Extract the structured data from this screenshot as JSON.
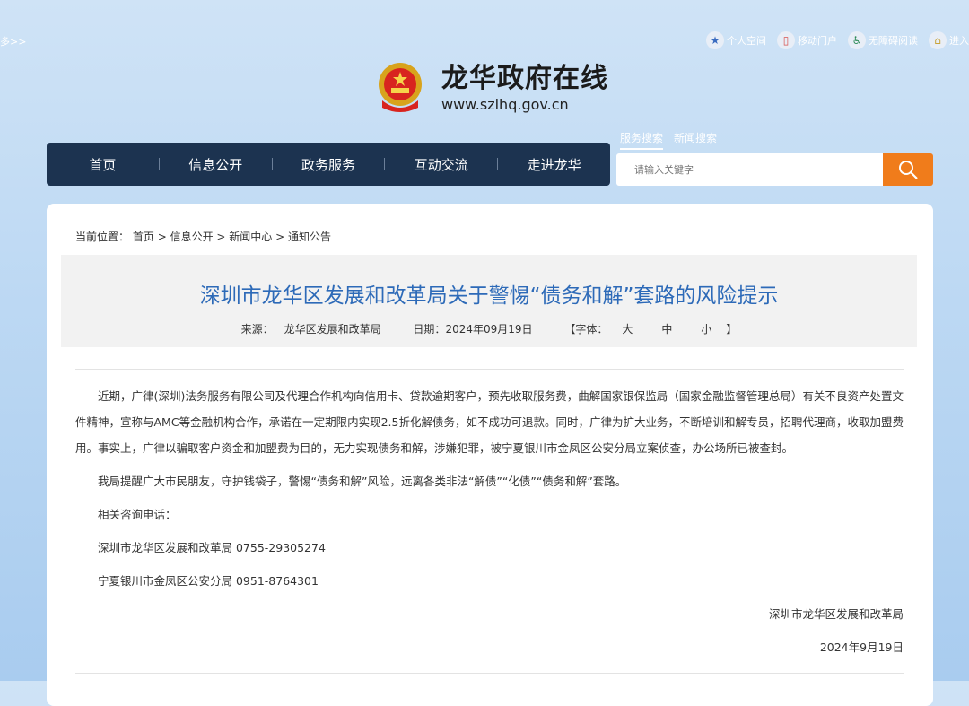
{
  "header": {
    "more_link": "多>>",
    "top_links": [
      {
        "label": "个人空间",
        "icon": "user-star-icon"
      },
      {
        "label": "移动门户",
        "icon": "mobile-icon"
      },
      {
        "label": "无障碍阅读",
        "icon": "accessibility-icon"
      },
      {
        "label": "进入",
        "icon": "enter-icon"
      }
    ],
    "site_title": "龙华政府在线",
    "site_url": "www.szlhq.gov.cn"
  },
  "nav": {
    "items": [
      "首页",
      "信息公开",
      "政务服务",
      "互动交流",
      "走进龙华"
    ]
  },
  "search": {
    "tabs": [
      "服务搜索",
      "新闻搜索"
    ],
    "placeholder": "请输入关键字"
  },
  "breadcrumb": {
    "label": "当前位置：",
    "items": [
      "首页",
      "信息公开",
      "新闻中心",
      "通知公告"
    ]
  },
  "article": {
    "title": "深圳市龙华区发展和改革局关于警惕“债务和解”套路的风险提示",
    "source_label": "来源：",
    "source": "龙华区发展和改革局",
    "date_label": "日期：",
    "date": "2024年09月19日",
    "font_label": "【字体：",
    "font_sizes": [
      "大",
      "中",
      "小"
    ],
    "font_close": "】",
    "paragraphs": [
      "近期，广律(深圳)法务服务有限公司及代理合作机构向信用卡、贷款逾期客户，预先收取服务费，曲解国家银保监局（国家金融监督管理总局）有关不良资产处置文件精神，宣称与AMC等金融机构合作，承诺在一定期限内实现2.5折化解债务，如不成功可退款。同时，广律为扩大业务，不断培训和解专员，招聘代理商，收取加盟费用。事实上，广律以骗取客户资金和加盟费为目的，无力实现债务和解，涉嫌犯罪，被宁夏银川市金凤区公安分局立案侦查，办公场所已被查封。",
      "我局提醒广大市民朋友，守护钱袋子，警惕“债务和解”风险，远离各类非法“解债”“化债”“债务和解”套路。",
      "相关咨询电话：",
      "深圳市龙华区发展和改革局 0755-29305274",
      "宁夏银川市金凤区公安分局 0951-8764301"
    ],
    "signature": "深圳市龙华区发展和改革局",
    "sign_date": "2024年9月19日"
  }
}
